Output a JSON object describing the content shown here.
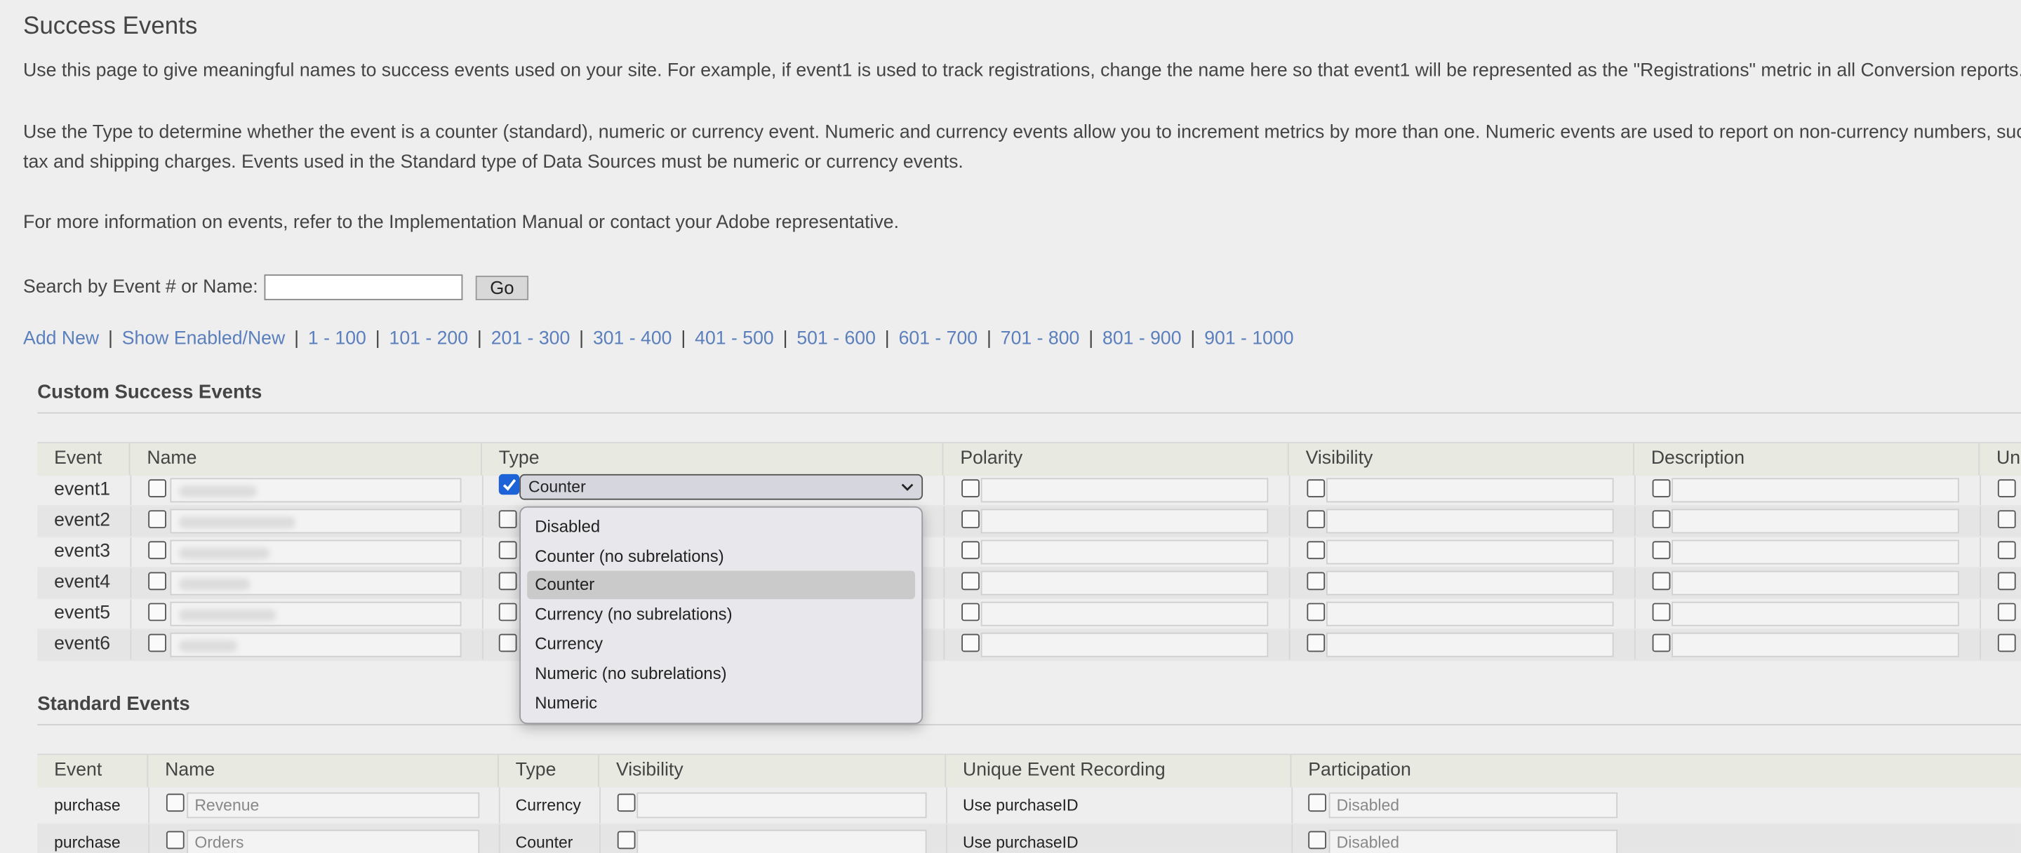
{
  "page": {
    "title": "Success Events",
    "intro": "Use this page to give meaningful names to success events used on your site. For example, if event1 is used to track registrations, change the name here so that event1 will be represented as the \"Registrations\" metric in all Conversion reports.",
    "type_info_line1": "Use the Type to determine whether the event is a counter (standard), numeric or currency event. Numeric and currency events allow you to increment metrics by more than one. Numeric events are used to report on non-currency numbers, such",
    "type_info_line2": "tax and shipping charges. Events used in the Standard type of Data Sources must be numeric or currency events.",
    "more_info": "For more information on events, refer to the Implementation Manual or contact your Adobe representative."
  },
  "search": {
    "label": "Search by Event # or Name:",
    "value": "",
    "go_label": "Go"
  },
  "nav_links": [
    "Add New",
    "Show Enabled/New",
    "1 - 100",
    "101 - 200",
    "201 - 300",
    "301 - 400",
    "401 - 500",
    "501 - 600",
    "601 - 700",
    "701 - 800",
    "801 - 900",
    "901 - 1000"
  ],
  "custom_events": {
    "title": "Custom Success Events",
    "headers": [
      "Event",
      "Name",
      "Type",
      "Polarity",
      "Visibility",
      "Description",
      "Un"
    ],
    "rows": [
      {
        "event": "event1"
      },
      {
        "event": "event2"
      },
      {
        "event": "event3"
      },
      {
        "event": "event4"
      },
      {
        "event": "event5"
      },
      {
        "event": "event6"
      }
    ],
    "type_select_value": "Counter",
    "type_options": [
      "Disabled",
      "Counter (no subrelations)",
      "Counter",
      "Currency (no subrelations)",
      "Currency",
      "Numeric (no subrelations)",
      "Numeric"
    ],
    "selected_option": "Counter"
  },
  "standard_events": {
    "title": "Standard Events",
    "headers": [
      "Event",
      "Name",
      "Type",
      "Visibility",
      "Unique Event Recording",
      "Participation"
    ],
    "rows": [
      {
        "event": "purchase",
        "name": "Revenue",
        "type": "Currency",
        "unique": "Use purchaseID",
        "participation": "Disabled"
      },
      {
        "event": "purchase",
        "name": "Orders",
        "type": "Counter",
        "unique": "Use purchaseID",
        "participation": "Disabled"
      }
    ]
  },
  "colors": {
    "link": "#5b7fbd",
    "checkbox_checked": "#1d62d6",
    "background": "#eeeeee"
  }
}
